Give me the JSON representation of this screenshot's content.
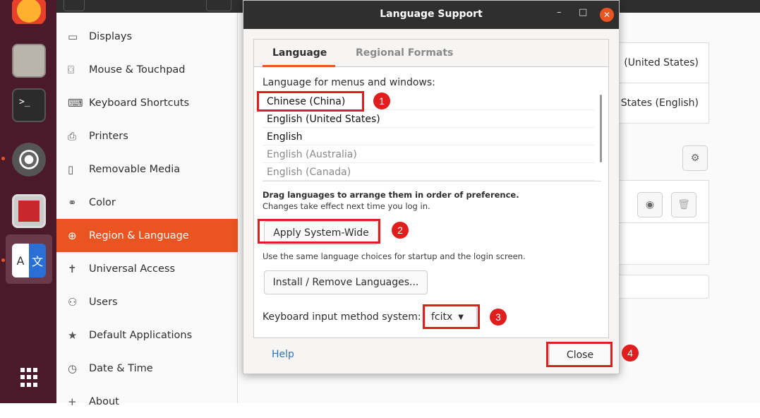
{
  "dialog": {
    "title": "Language Support",
    "minimize": "–",
    "maximize": "□",
    "close_x": "✕",
    "tabs": [
      "Language",
      "Regional Formats"
    ],
    "menus_label": "Language for menus and windows:",
    "languages": [
      "Chinese (China)",
      "English (United States)",
      "English",
      "English (Australia)",
      "English (Canada)"
    ],
    "drag_hint": "Drag languages to arrange them in order of preference.",
    "changes_hint": "Changes take effect next time you log in.",
    "apply_button": "Apply System-Wide",
    "apply_hint": "Use the same language choices for startup and the login screen.",
    "install_button": "Install / Remove Languages...",
    "input_label": "Keyboard input method system:",
    "input_value": "fcitx",
    "help_link": "Help",
    "close_button": "Close"
  },
  "sidebar": {
    "items": [
      {
        "icon": "display-icon",
        "glyph": "▭",
        "label": "Displays"
      },
      {
        "icon": "mouse-icon",
        "glyph": "⌼",
        "label": "Mouse & Touchpad"
      },
      {
        "icon": "keyboard-icon",
        "glyph": "⌨",
        "label": "Keyboard Shortcuts"
      },
      {
        "icon": "printer-icon",
        "glyph": "⎙",
        "label": "Printers"
      },
      {
        "icon": "removable-media-icon",
        "glyph": "▯",
        "label": "Removable Media"
      },
      {
        "icon": "color-icon",
        "glyph": "⚭",
        "label": "Color"
      },
      {
        "icon": "globe-icon",
        "glyph": "⊕",
        "label": "Region & Language"
      },
      {
        "icon": "accessibility-icon",
        "glyph": "✝",
        "label": "Universal Access"
      },
      {
        "icon": "users-icon",
        "glyph": "⚇",
        "label": "Users"
      },
      {
        "icon": "star-icon",
        "glyph": "★",
        "label": "Default Applications"
      },
      {
        "icon": "clock-icon",
        "glyph": "◷",
        "label": "Date & Time"
      },
      {
        "icon": "plus-icon",
        "glyph": "+",
        "label": "About"
      }
    ],
    "active_index": 6
  },
  "background": {
    "row1": "(United States)",
    "row2": "States (English)"
  },
  "annotations": [
    "1",
    "2",
    "3",
    "4"
  ],
  "colors": {
    "accent": "#e95420",
    "highlight": "#e01e1e",
    "titlebar": "#2f2f2f",
    "dock": "#4a1a2b"
  }
}
